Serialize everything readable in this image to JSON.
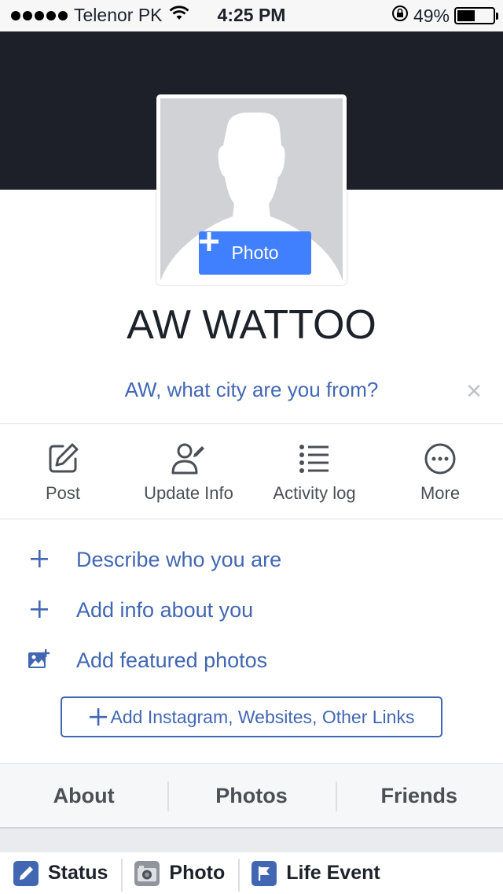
{
  "status_bar": {
    "carrier": "Telenor PK",
    "time": "4:25 PM",
    "battery_percent": "49%",
    "battery_level": 0.49,
    "icons": [
      "signal-dots-icon",
      "wifi-icon",
      "rotation-lock-icon",
      "battery-icon"
    ]
  },
  "profile": {
    "name": "AW WATTOO",
    "add_photo_label": "Photo"
  },
  "prompt": {
    "question": "AW, what city are you from?",
    "close_symbol": "✕"
  },
  "actions": [
    {
      "label": "Post",
      "icon": "edit-icon"
    },
    {
      "label": "Update Info",
      "icon": "user-edit-icon"
    },
    {
      "label": "Activity log",
      "icon": "list-icon"
    },
    {
      "label": "More",
      "icon": "more-icon"
    }
  ],
  "intro_items": [
    {
      "label": "Describe who you are",
      "icon": "plus-icon"
    },
    {
      "label": "Add info about you",
      "icon": "plus-icon"
    },
    {
      "label": "Add featured photos",
      "icon": "photo-add-icon"
    }
  ],
  "links_button": {
    "label": "Add Instagram, Websites, Other Links"
  },
  "tabs": [
    {
      "label": "About"
    },
    {
      "label": "Photos"
    },
    {
      "label": "Friends"
    }
  ],
  "composer": [
    {
      "label": "Status",
      "icon": "pencil-icon"
    },
    {
      "label": "Photo",
      "icon": "camera-icon"
    },
    {
      "label": "Life Event",
      "icon": "flag-icon"
    }
  ],
  "colors": {
    "cover": "#1d2029",
    "accent_blue": "#4080ff",
    "link_blue": "#4267b2",
    "text_gray": "#4b4f56"
  }
}
